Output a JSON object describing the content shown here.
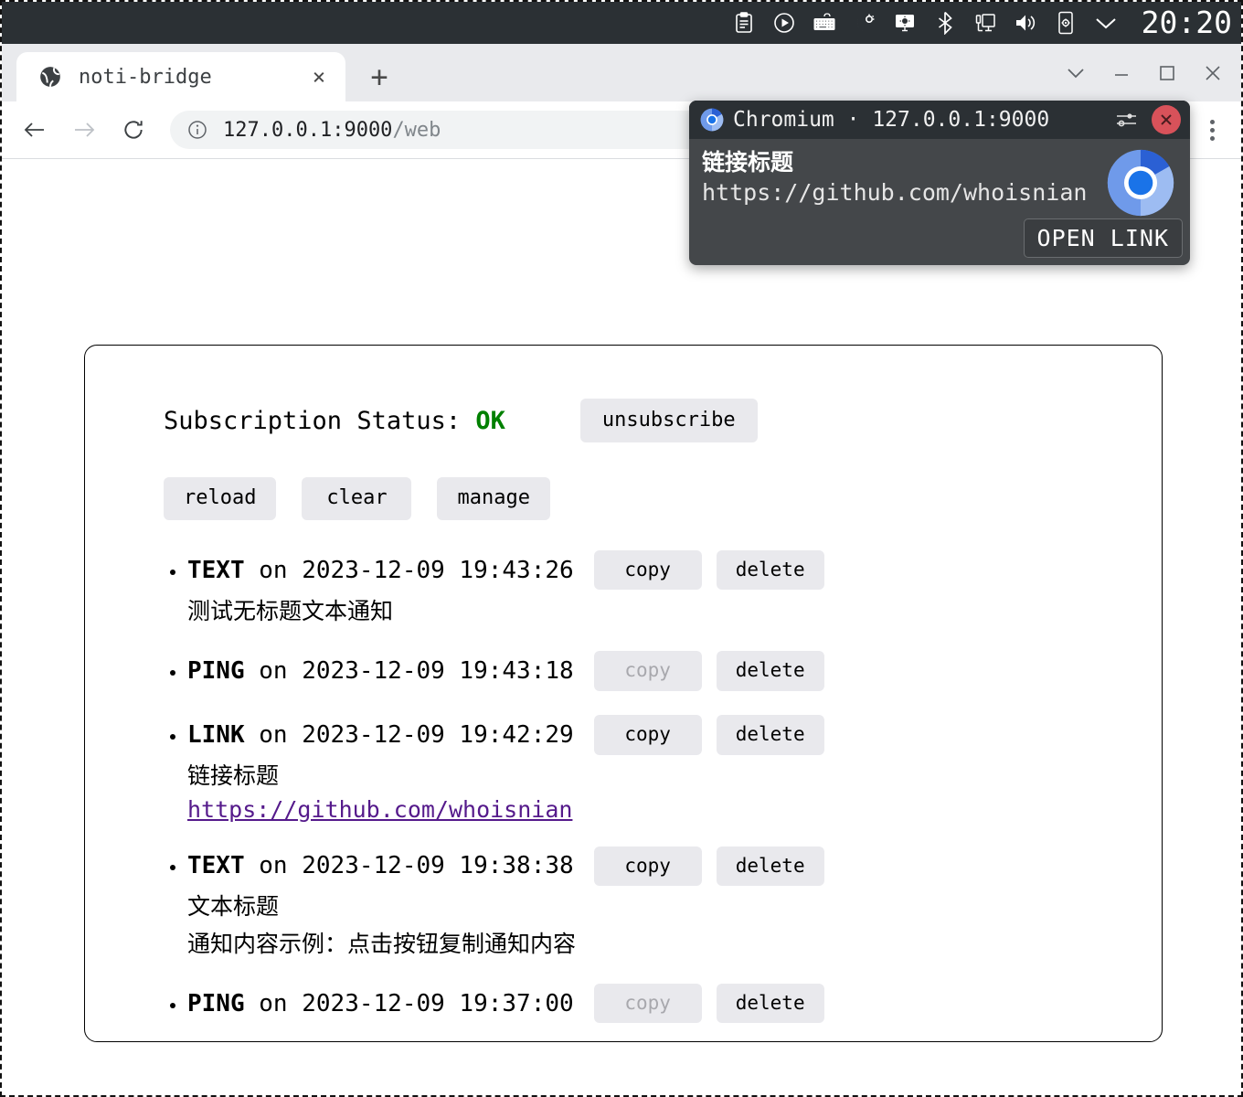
{
  "systembar": {
    "clock": "20:20",
    "tray_icons": [
      {
        "name": "clipboard-icon",
        "label": "clipboard"
      },
      {
        "name": "media-play-icon",
        "label": "media player"
      },
      {
        "name": "keyboard-icon",
        "label": "keyboard"
      },
      {
        "name": "night-light-icon",
        "label": "night light"
      },
      {
        "name": "display-brightness-icon",
        "label": "display brightness"
      },
      {
        "name": "bluetooth-icon",
        "label": "bluetooth"
      },
      {
        "name": "network-display-icon",
        "label": "network display"
      },
      {
        "name": "volume-icon",
        "label": "volume"
      },
      {
        "name": "mobile-settings-icon",
        "label": "mobile device"
      },
      {
        "name": "chevron-down-icon",
        "label": "show more"
      }
    ]
  },
  "browser": {
    "tab": {
      "title": "noti-bridge",
      "favicon": "globe-icon",
      "close_label": "×"
    },
    "new_tab_label": "+",
    "window_controls": {
      "chevron": "chevron-down-icon",
      "minimize": "minimize-icon",
      "maximize": "maximize-icon",
      "close": "close-icon"
    },
    "toolbar": {
      "back": "back-arrow-icon",
      "forward": "forward-arrow-icon",
      "reload": "reload-icon",
      "site_info": "info-circle-icon",
      "url_host": "127.0.0.1:9000",
      "url_path": "/web",
      "menu": "three-dots-icon"
    }
  },
  "page": {
    "status_label": "Subscription Status: ",
    "status_value": "OK",
    "status_color": "#008000",
    "unsubscribe_label": "unsubscribe",
    "actions": [
      {
        "label": "reload"
      },
      {
        "label": "clear"
      },
      {
        "label": "manage"
      }
    ],
    "copy_label": "copy",
    "delete_label": "delete",
    "notifications": [
      {
        "type": "TEXT",
        "on": " on ",
        "timestamp": "2023-12-09 19:43:26",
        "title": "",
        "body": "测试无标题文本通知",
        "link": "",
        "copy_enabled": true
      },
      {
        "type": "PING",
        "on": " on ",
        "timestamp": "2023-12-09 19:43:18",
        "title": "",
        "body": "",
        "link": "",
        "copy_enabled": false
      },
      {
        "type": "LINK",
        "on": " on ",
        "timestamp": "2023-12-09 19:42:29",
        "title": "链接标题",
        "body": "",
        "link": "https://github.com/whoisnian",
        "copy_enabled": true
      },
      {
        "type": "TEXT",
        "on": " on ",
        "timestamp": "2023-12-09 19:38:38",
        "title": "文本标题",
        "body": "通知内容示例：点击按钮复制通知内容",
        "link": "",
        "copy_enabled": true
      },
      {
        "type": "PING",
        "on": " on ",
        "timestamp": "2023-12-09 19:37:00",
        "title": "",
        "body": "",
        "link": "",
        "copy_enabled": false
      }
    ]
  },
  "notification_popup": {
    "app_title": "Chromium · 127.0.0.1:9000",
    "settings_icon": "sliders-icon",
    "close_icon": "close-circle-icon",
    "title": "链接标题",
    "text": "https://github.com/whoisnian",
    "logo": "chromium-logo-icon",
    "action_label": "OPEN LINK"
  }
}
